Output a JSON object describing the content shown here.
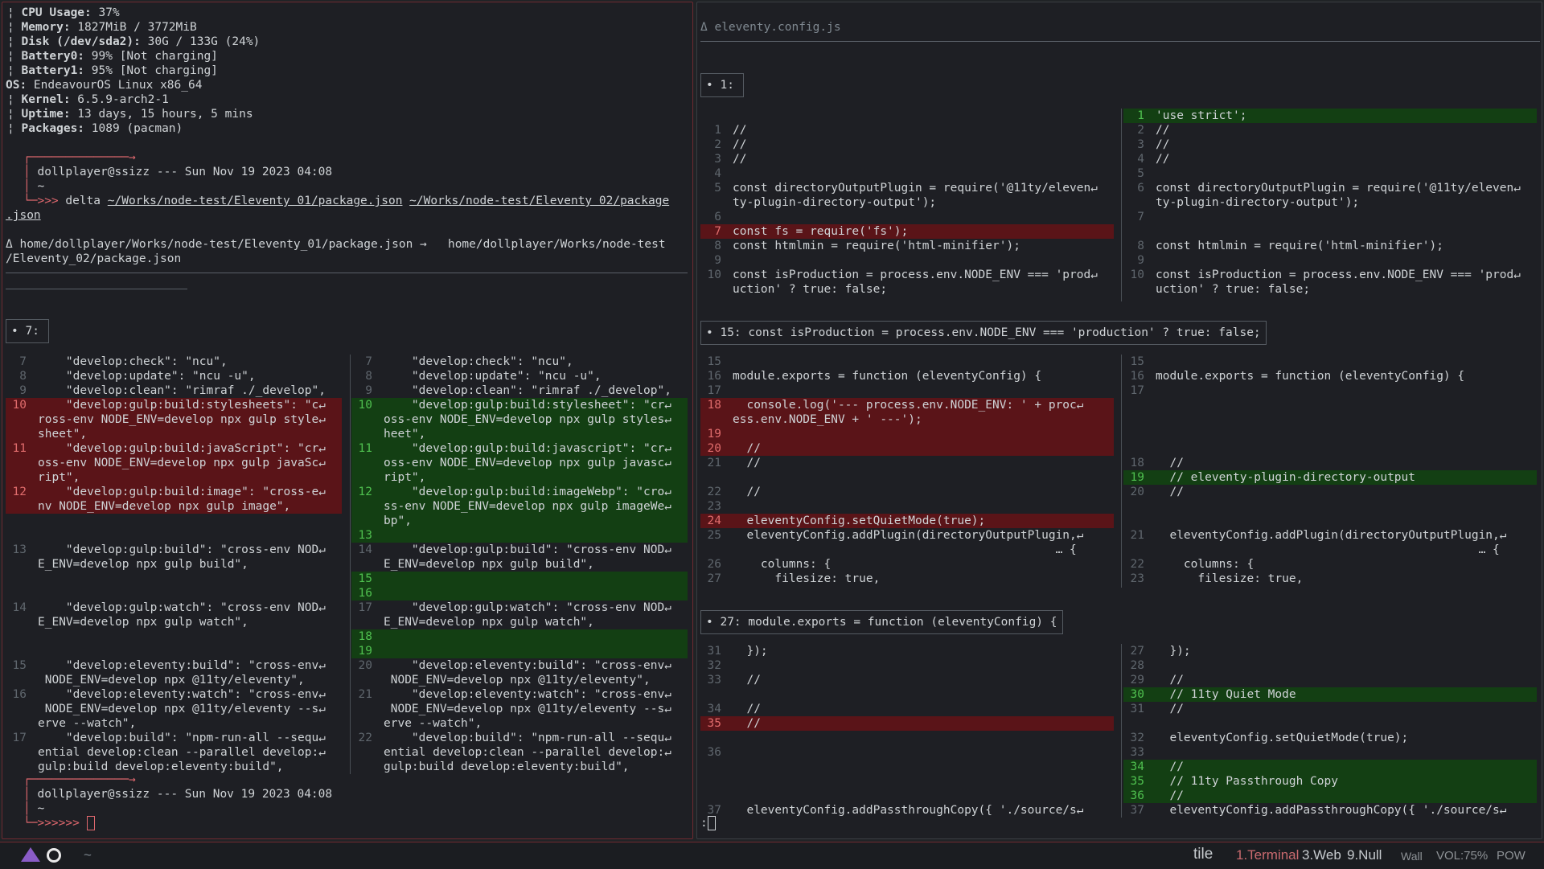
{
  "sysinfo": {
    "cpu": [
      "CPU Usage:",
      " 37%"
    ],
    "mem": [
      "Memory:",
      " 1827MiB / 3772MiB"
    ],
    "disk": [
      "Disk (/dev/sda2):",
      " 30G / 133G (24%)"
    ],
    "bat0": [
      "Battery0:",
      " 99% [Not charging]"
    ],
    "bat1": [
      "Battery1:",
      " 95% [Not charging]"
    ],
    "os": [
      "OS:",
      " EndeavourOS Linux x86_64"
    ],
    "kernel": [
      "Kernel:",
      " 6.5.9-arch2-1"
    ],
    "uptime": [
      "Uptime:",
      " 13 days, 15 hours, 5 mins"
    ],
    "packages": [
      "Packages:",
      " 1089 (pacman)"
    ]
  },
  "prompt1": {
    "user": "dollplayer@ssizz --- Sun Nov 19 2023 04:08",
    "home": "~",
    "arrows": ">>> ",
    "cmd": "delta ",
    "arg1": "~/Works/node-test/Eleventy 01/package.json",
    "arg2": "~/Works/node-test/Eleventy 02/package",
    "arg2b": ".json"
  },
  "leftdiff": {
    "header1": "Δ home/dollplayer/Works/node-test/Eleventy_01/package.json →   home/dollplayer/Works/node-test",
    "header2": "/Eleventy_02/package.json",
    "hunk": "• 7:"
  },
  "prompt2": {
    "user": "dollplayer@ssizz --- Sun Nov 19 2023 04:08",
    "home": "~",
    "arrows": ">>>>>> "
  },
  "rightdiff": {
    "file": "Δ eleventy.config.js",
    "hunk1": "• 1:",
    "hunk2": "• 15: const isProduction = process.env.NODE_ENV === 'production' ? true: false;",
    "hunk3": "• 27: module.exports = function (eleventyConfig) {",
    "cmdline": ":"
  },
  "taskbar": {
    "layout": "tile",
    "ws1": "1.Terminal",
    "ws2": "3.Web",
    "ws3": "9.Null",
    "wall": "Wall",
    "vol": "VOL:75%",
    "pow": "POW",
    "tilde": "~"
  },
  "left_rows": [
    {
      "a": "7",
      "b": "    \"develop:check\": \"ncu\",",
      "c": "7",
      "d": "    \"develop:check\": \"ncu\","
    },
    {
      "a": "8",
      "b": "    \"develop:update\": \"ncu -u\",",
      "c": "8",
      "d": "    \"develop:update\": \"ncu -u\","
    },
    {
      "a": "9",
      "b": "    \"develop:clean\": \"rimraf ./_develop\",",
      "c": "9",
      "d": "    \"develop:clean\": \"rimraf ./_develop\","
    },
    {
      "a": "10",
      "b": "    \"develop:gulp:build:stylesheets\": \"c↵",
      "c": "10",
      "d": "    \"develop:gulp:build:stylesheet\": \"cr↵",
      "k": "m"
    },
    {
      "a": "",
      "b": "ross-env NODE_ENV=develop npx gulp style↵",
      "c": "",
      "d": "oss-env NODE_ENV=develop npx gulp styles↵",
      "k": "m"
    },
    {
      "a": "",
      "b": "sheet\",",
      "c": "",
      "d": "heet\",",
      "k": "m"
    },
    {
      "a": "11",
      "b": "    \"develop:gulp:build:javaScript\": \"cr↵",
      "c": "11",
      "d": "    \"develop:gulp:build:javascript\": \"cr↵",
      "k": "m"
    },
    {
      "a": "",
      "b": "oss-env NODE_ENV=develop npx gulp javaSc↵",
      "c": "",
      "d": "oss-env NODE_ENV=develop npx gulp javasc↵",
      "k": "m"
    },
    {
      "a": "",
      "b": "ript\",",
      "c": "",
      "d": "ript\",",
      "k": "m"
    },
    {
      "a": "12",
      "b": "    \"develop:gulp:build:image\": \"cross-e↵",
      "c": "12",
      "d": "    \"develop:gulp:build:imageWebp\": \"cro↵",
      "k": "m"
    },
    {
      "a": "",
      "b": "nv NODE_ENV=develop npx gulp image\",",
      "c": "",
      "d": "ss-env NODE_ENV=develop npx gulp imageWe↵",
      "k": "m"
    },
    {
      "a": "",
      "b": "",
      "c": "",
      "d": "bp\",",
      "k": "p"
    },
    {
      "a": "",
      "b": "",
      "c": "13",
      "d": "",
      "k": "p"
    },
    {
      "a": "13",
      "b": "    \"develop:gulp:build\": \"cross-env NOD↵",
      "c": "14",
      "d": "    \"develop:gulp:build\": \"cross-env NOD↵"
    },
    {
      "a": "",
      "b": "E_ENV=develop npx gulp build\",",
      "c": "",
      "d": "E_ENV=develop npx gulp build\","
    },
    {
      "a": "",
      "b": "",
      "c": "15",
      "d": "",
      "k": "p"
    },
    {
      "a": "",
      "b": "",
      "c": "16",
      "d": "",
      "k": "p"
    },
    {
      "a": "14",
      "b": "    \"develop:gulp:watch\": \"cross-env NOD↵",
      "c": "17",
      "d": "    \"develop:gulp:watch\": \"cross-env NOD↵"
    },
    {
      "a": "",
      "b": "E_ENV=develop npx gulp watch\",",
      "c": "",
      "d": "E_ENV=develop npx gulp watch\","
    },
    {
      "a": "",
      "b": "",
      "c": "18",
      "d": "",
      "k": "p"
    },
    {
      "a": "",
      "b": "",
      "c": "19",
      "d": "",
      "k": "p"
    },
    {
      "a": "15",
      "b": "    \"develop:eleventy:build\": \"cross-env↵",
      "c": "20",
      "d": "    \"develop:eleventy:build\": \"cross-env↵"
    },
    {
      "a": "",
      "b": " NODE_ENV=develop npx @11ty/eleventy\",",
      "c": "",
      "d": " NODE_ENV=develop npx @11ty/eleventy\","
    },
    {
      "a": "16",
      "b": "    \"develop:eleventy:watch\": \"cross-env↵",
      "c": "21",
      "d": "    \"develop:eleventy:watch\": \"cross-env↵"
    },
    {
      "a": "",
      "b": " NODE_ENV=develop npx @11ty/eleventy --s↵",
      "c": "",
      "d": " NODE_ENV=develop npx @11ty/eleventy --s↵"
    },
    {
      "a": "",
      "b": "erve --watch\",",
      "c": "",
      "d": "erve --watch\","
    },
    {
      "a": "17",
      "b": "    \"develop:build\": \"npm-run-all --sequ↵",
      "c": "22",
      "d": "    \"develop:build\": \"npm-run-all --sequ↵"
    },
    {
      "a": "",
      "b": "ential develop:clean --parallel develop:↵",
      "c": "",
      "d": "ential develop:clean --parallel develop:↵"
    },
    {
      "a": "",
      "b": "gulp:build develop:eleventy:build\",",
      "c": "",
      "d": "gulp:build develop:eleventy:build\","
    }
  ],
  "right_rows1": [
    {
      "a": "",
      "b": "",
      "c": "1",
      "d": "'use strict';",
      "k": "p1"
    },
    {
      "a": "1",
      "b": "//",
      "c": "2",
      "d": "//"
    },
    {
      "a": "2",
      "b": "//",
      "c": "3",
      "d": "//"
    },
    {
      "a": "3",
      "b": "//",
      "c": "4",
      "d": "//"
    },
    {
      "a": "4",
      "b": "",
      "c": "5",
      "d": ""
    },
    {
      "a": "5",
      "b": "const directoryOutputPlugin = require('@11ty/eleven↵",
      "c": "6",
      "d": "const directoryOutputPlugin = require('@11ty/eleven↵"
    },
    {
      "a": "",
      "b": "ty-plugin-directory-output');",
      "c": "",
      "d": "ty-plugin-directory-output');"
    },
    {
      "a": "6",
      "b": "",
      "c": "7",
      "d": ""
    },
    {
      "a": "7",
      "b": "const fs = require('fs');",
      "c": "",
      "d": "",
      "k": "m1"
    },
    {
      "a": "8",
      "b": "const htmlmin = require('html-minifier');",
      "c": "8",
      "d": "const htmlmin = require('html-minifier');"
    },
    {
      "a": "9",
      "b": "",
      "c": "9",
      "d": ""
    },
    {
      "a": "10",
      "b": "const isProduction = process.env.NODE_ENV === 'prod↵",
      "c": "10",
      "d": "const isProduction = process.env.NODE_ENV === 'prod↵"
    },
    {
      "a": "",
      "b": "uction' ? true: false;",
      "c": "",
      "d": "uction' ? true: false;"
    }
  ],
  "right_rows2": [
    {
      "a": "15",
      "b": "",
      "c": "15",
      "d": ""
    },
    {
      "a": "16",
      "b": "module.exports = function (eleventyConfig) {",
      "c": "16",
      "d": "module.exports = function (eleventyConfig) {"
    },
    {
      "a": "17",
      "b": "",
      "c": "17",
      "d": ""
    },
    {
      "a": "18",
      "b": "  console.log('--- process.env.NODE_ENV: ' + proc↵",
      "c": "",
      "d": "",
      "k": "m1"
    },
    {
      "a": "",
      "b": "ess.env.NODE_ENV + ' ---');",
      "c": "",
      "d": "",
      "k": "m1"
    },
    {
      "a": "19",
      "b": "",
      "c": "",
      "d": "",
      "k": "m1"
    },
    {
      "a": "20",
      "b": "  //",
      "c": "",
      "d": "",
      "k": "m1"
    },
    {
      "a": "21",
      "b": "  //",
      "c": "18",
      "d": "  //"
    },
    {
      "a": "",
      "b": "",
      "c": "19",
      "d": "  // eleventy-plugin-directory-output",
      "k": "p1"
    },
    {
      "a": "22",
      "b": "  //",
      "c": "20",
      "d": "  //"
    },
    {
      "a": "23",
      "b": "",
      "c": "",
      "d": ""
    },
    {
      "a": "24",
      "b": "  eleventyConfig.setQuietMode(true);",
      "c": "",
      "d": "",
      "k": "m1"
    },
    {
      "a": "25",
      "b": "  eleventyConfig.addPlugin(directoryOutputPlugin,↵",
      "c": "21",
      "d": "  eleventyConfig.addPlugin(directoryOutputPlugin,↵"
    },
    {
      "a": "",
      "b": "                                              … {",
      "c": "",
      "d": "                                              … {"
    },
    {
      "a": "26",
      "b": "    columns: {",
      "c": "22",
      "d": "    columns: {"
    },
    {
      "a": "27",
      "b": "      filesize: true,",
      "c": "23",
      "d": "      filesize: true,"
    }
  ],
  "right_rows3": [
    {
      "a": "31",
      "b": "  });",
      "c": "27",
      "d": "  });"
    },
    {
      "a": "32",
      "b": "",
      "c": "28",
      "d": ""
    },
    {
      "a": "33",
      "b": "  //",
      "c": "29",
      "d": "  //"
    },
    {
      "a": "",
      "b": "",
      "c": "30",
      "d": "  // 11ty Quiet Mode",
      "k": "p1"
    },
    {
      "a": "34",
      "b": "  //",
      "c": "31",
      "d": "  //"
    },
    {
      "a": "35",
      "b": "  //",
      "c": "",
      "d": "",
      "k": "m1"
    },
    {
      "a": "",
      "b": "",
      "c": "32",
      "d": "  eleventyConfig.setQuietMode(true);"
    },
    {
      "a": "36",
      "b": "",
      "c": "33",
      "d": ""
    },
    {
      "a": "",
      "b": "",
      "c": "34",
      "d": "  //",
      "k": "p1"
    },
    {
      "a": "",
      "b": "",
      "c": "35",
      "d": "  // 11ty Passthrough Copy",
      "k": "p1"
    },
    {
      "a": "",
      "b": "",
      "c": "36",
      "d": "  //",
      "k": "p1"
    },
    {
      "a": "37",
      "b": "  eleventyConfig.addPassthroughCopy({ './source/s↵",
      "c": "37",
      "d": "  eleventyConfig.addPassthroughCopy({ './source/s↵"
    }
  ],
  "colors": {
    "accent": "#e0686e",
    "plus": "#1f7a1f",
    "minus": "#9a2a30",
    "bg": "#202326"
  }
}
